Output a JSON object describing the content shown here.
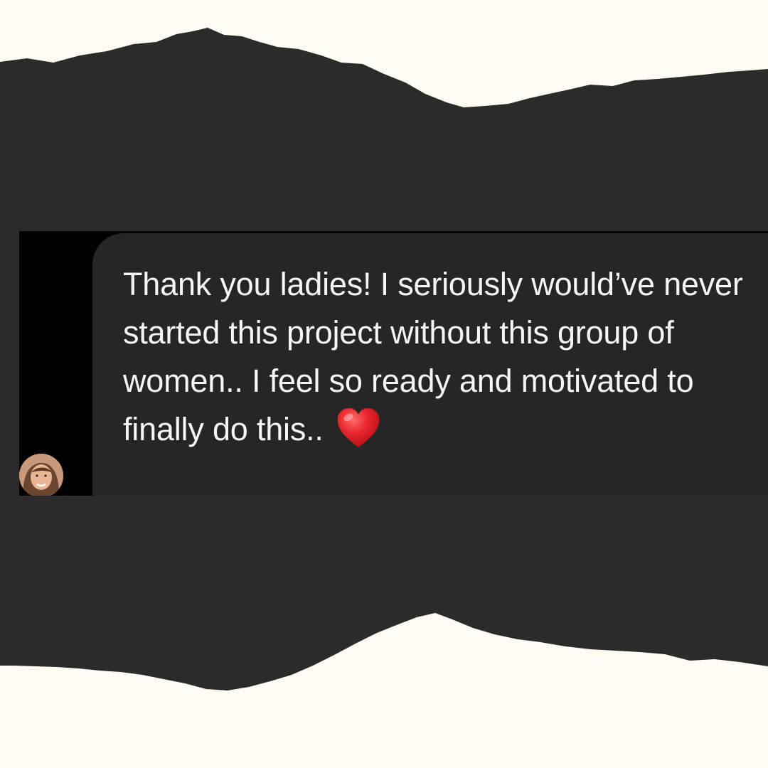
{
  "message": {
    "text": "Thank you ladies! I seriously would’ve never started this project without this group of women.. I feel so ready and motivated to finally do this..",
    "emoji_icon": "red-heart-icon"
  },
  "colors": {
    "paper": "#fdfdf3",
    "torn_band": "#2b2b2b",
    "app_background": "#000000",
    "bubble": "#262626",
    "text": "#f6f6f6",
    "heart": "#e8282d"
  }
}
